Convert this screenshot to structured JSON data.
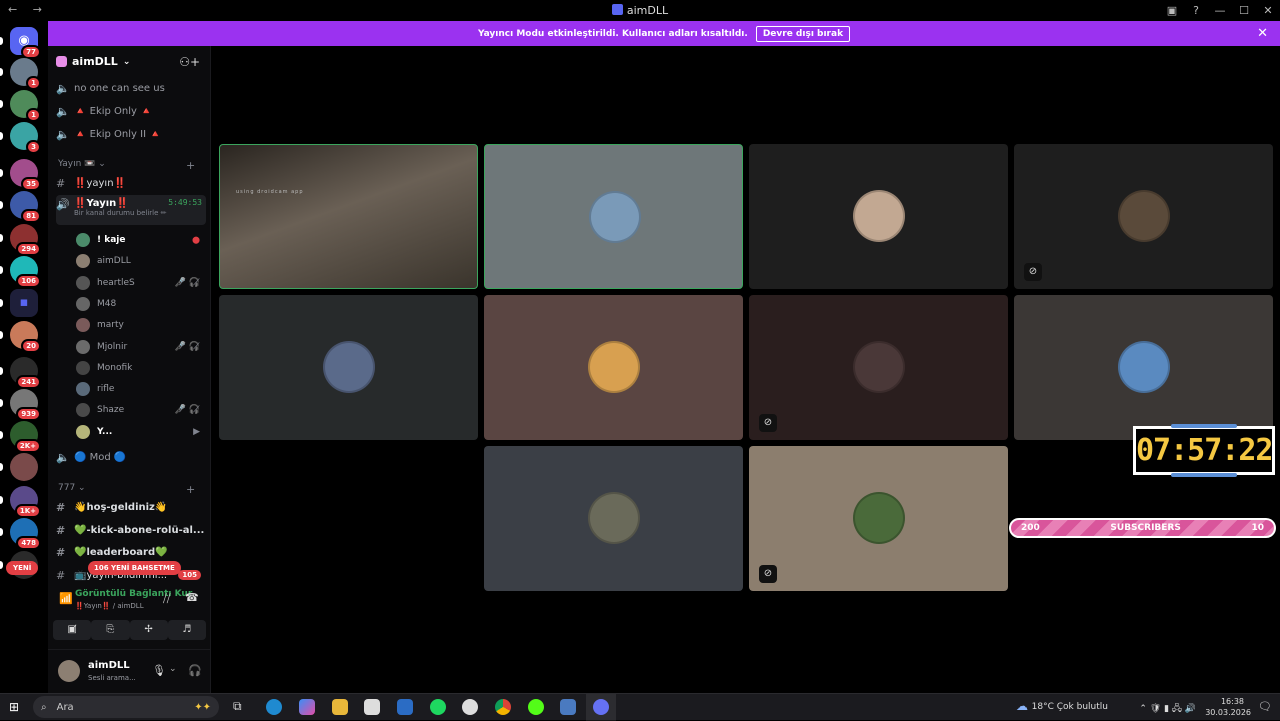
{
  "window": {
    "title": "aimDLL",
    "nav": "← →"
  },
  "banner": {
    "text": "Yayıncı Modu etkinleştirildi. Kullanıcı adları kısaltıldı.",
    "button": "Devre dışı bırak"
  },
  "servers": [
    {
      "badge": "77",
      "color": "#5865f2",
      "icon": "discord-icon"
    },
    {
      "badge": "1",
      "color": "#6a7b8c"
    },
    {
      "badge": "1",
      "color": "#4f8b5a"
    },
    {
      "badge": "3",
      "color": "#3aa4a4"
    },
    {
      "badge": "35",
      "color": "#a24d8c"
    },
    {
      "badge": "81",
      "color": "#3d5aa8"
    },
    {
      "badge": "294",
      "color": "#8d3030"
    },
    {
      "badge": "106",
      "color": "#1fb8b8"
    },
    {
      "badge": "",
      "color": "#5865f2",
      "icon": "folder-icon"
    },
    {
      "badge": "20",
      "color": "#c97a5a"
    },
    {
      "badge": "241",
      "color": "#2a2a2a"
    },
    {
      "badge": "939",
      "color": "#777"
    },
    {
      "badge": "2K+",
      "color": "#2d5d2d"
    },
    {
      "badge": "",
      "color": "#7a4a4a"
    },
    {
      "badge": "1K+",
      "color": "#5a4a8a"
    },
    {
      "badge": "478",
      "color": "#1e6fb5"
    },
    {
      "badge": "",
      "color": "#2a2a2a"
    }
  ],
  "new_badge": "YENİ",
  "sidebar": {
    "guild_name": "aimDLL",
    "channels_top": [
      {
        "name": "no one can see us",
        "icon": "speaker-muted-icon"
      },
      {
        "name": "🔺 Ekip Only 🔺",
        "icon": "speaker-muted-icon"
      },
      {
        "name": "🔺 Ekip Only II 🔺",
        "icon": "speaker-muted-icon"
      }
    ],
    "category1": "Yayın 📼",
    "text_channel": "‼️yayın‼️",
    "voice_channel": {
      "name": "‼️Yayın‼️",
      "time": "5:49:53",
      "status": "Bir kanal durumu belirle ✏"
    },
    "users": [
      {
        "name": "! kaje",
        "color": "#4b8b6a",
        "bold": true
      },
      {
        "name": "aimDLL",
        "color": "#8c7f72"
      },
      {
        "name": "heartleS",
        "color": "#555",
        "icons": "🎤̸ 🎧̸"
      },
      {
        "name": "M48",
        "color": "#666"
      },
      {
        "name": "marty",
        "color": "#7a5a5a"
      },
      {
        "name": "Mjolnir",
        "color": "#6b6b6b",
        "icons": "🎤̸ 🎧̸"
      },
      {
        "name": "Monofik",
        "color": "#444"
      },
      {
        "name": "rifle",
        "color": "#5a6a7a"
      },
      {
        "name": "Shaze",
        "color": "#4a4a4a",
        "icons": "🎤̸ 🎧̸"
      },
      {
        "name": "Y...",
        "color": "#b5b57a",
        "bold": true
      }
    ],
    "mod_channel": "🔵 Mod 🔵",
    "category2": "777",
    "channels_bottom": [
      {
        "name": "👋hoş-geldiniz👋"
      },
      {
        "name": "💚-kick-abone-rolü-al..."
      },
      {
        "name": "💚leaderboard💚"
      },
      {
        "name": "📺yayın-bildirimi..."
      }
    ],
    "mention_badge": "106 YENİ BAHSETME",
    "unread_count": "105"
  },
  "voice_panel": {
    "title": "Görüntülü Bağlantı Kur",
    "subtitle": "‼️Yayın‼️ / aimDLL"
  },
  "user_panel": {
    "name": "aimDLL",
    "status": "Sesli arama..."
  },
  "tiles": [
    {
      "color": "#3d3832",
      "avatar": "#9a8a78",
      "speaking": true,
      "overlay": "using droidcam app"
    },
    {
      "color": "#6e7779",
      "avatar": "#7a9ab8",
      "speaking": true
    },
    {
      "color": "#1e1e1e",
      "avatar": "#c2a892"
    },
    {
      "color": "#1e1e1e",
      "avatar": "#5a4a3a",
      "muted_video": true
    },
    {
      "color": "#272a2b",
      "avatar": "#5a6a8a"
    },
    {
      "color": "#5a4542",
      "avatar": "#d8a050"
    },
    {
      "color": "#2a1e1e",
      "avatar": "#4a3838",
      "muted_video": true
    },
    {
      "color": "#3b3735",
      "avatar": "#5a8ac0"
    },
    {
      "color": "#3b3f46",
      "avatar": "#6a6a5a"
    },
    {
      "color": "#8c7e6e",
      "avatar": "#4a6a3a",
      "muted_video": true
    }
  ],
  "overlay_clock": "07:57:22",
  "subscribers": {
    "left": "200",
    "label": "SUBSCRIBERS",
    "right": "10"
  },
  "taskbar": {
    "search": "Ara",
    "weather": "18°C  Çok bulutlu",
    "time": "16:38",
    "date": "30.03.2026"
  }
}
